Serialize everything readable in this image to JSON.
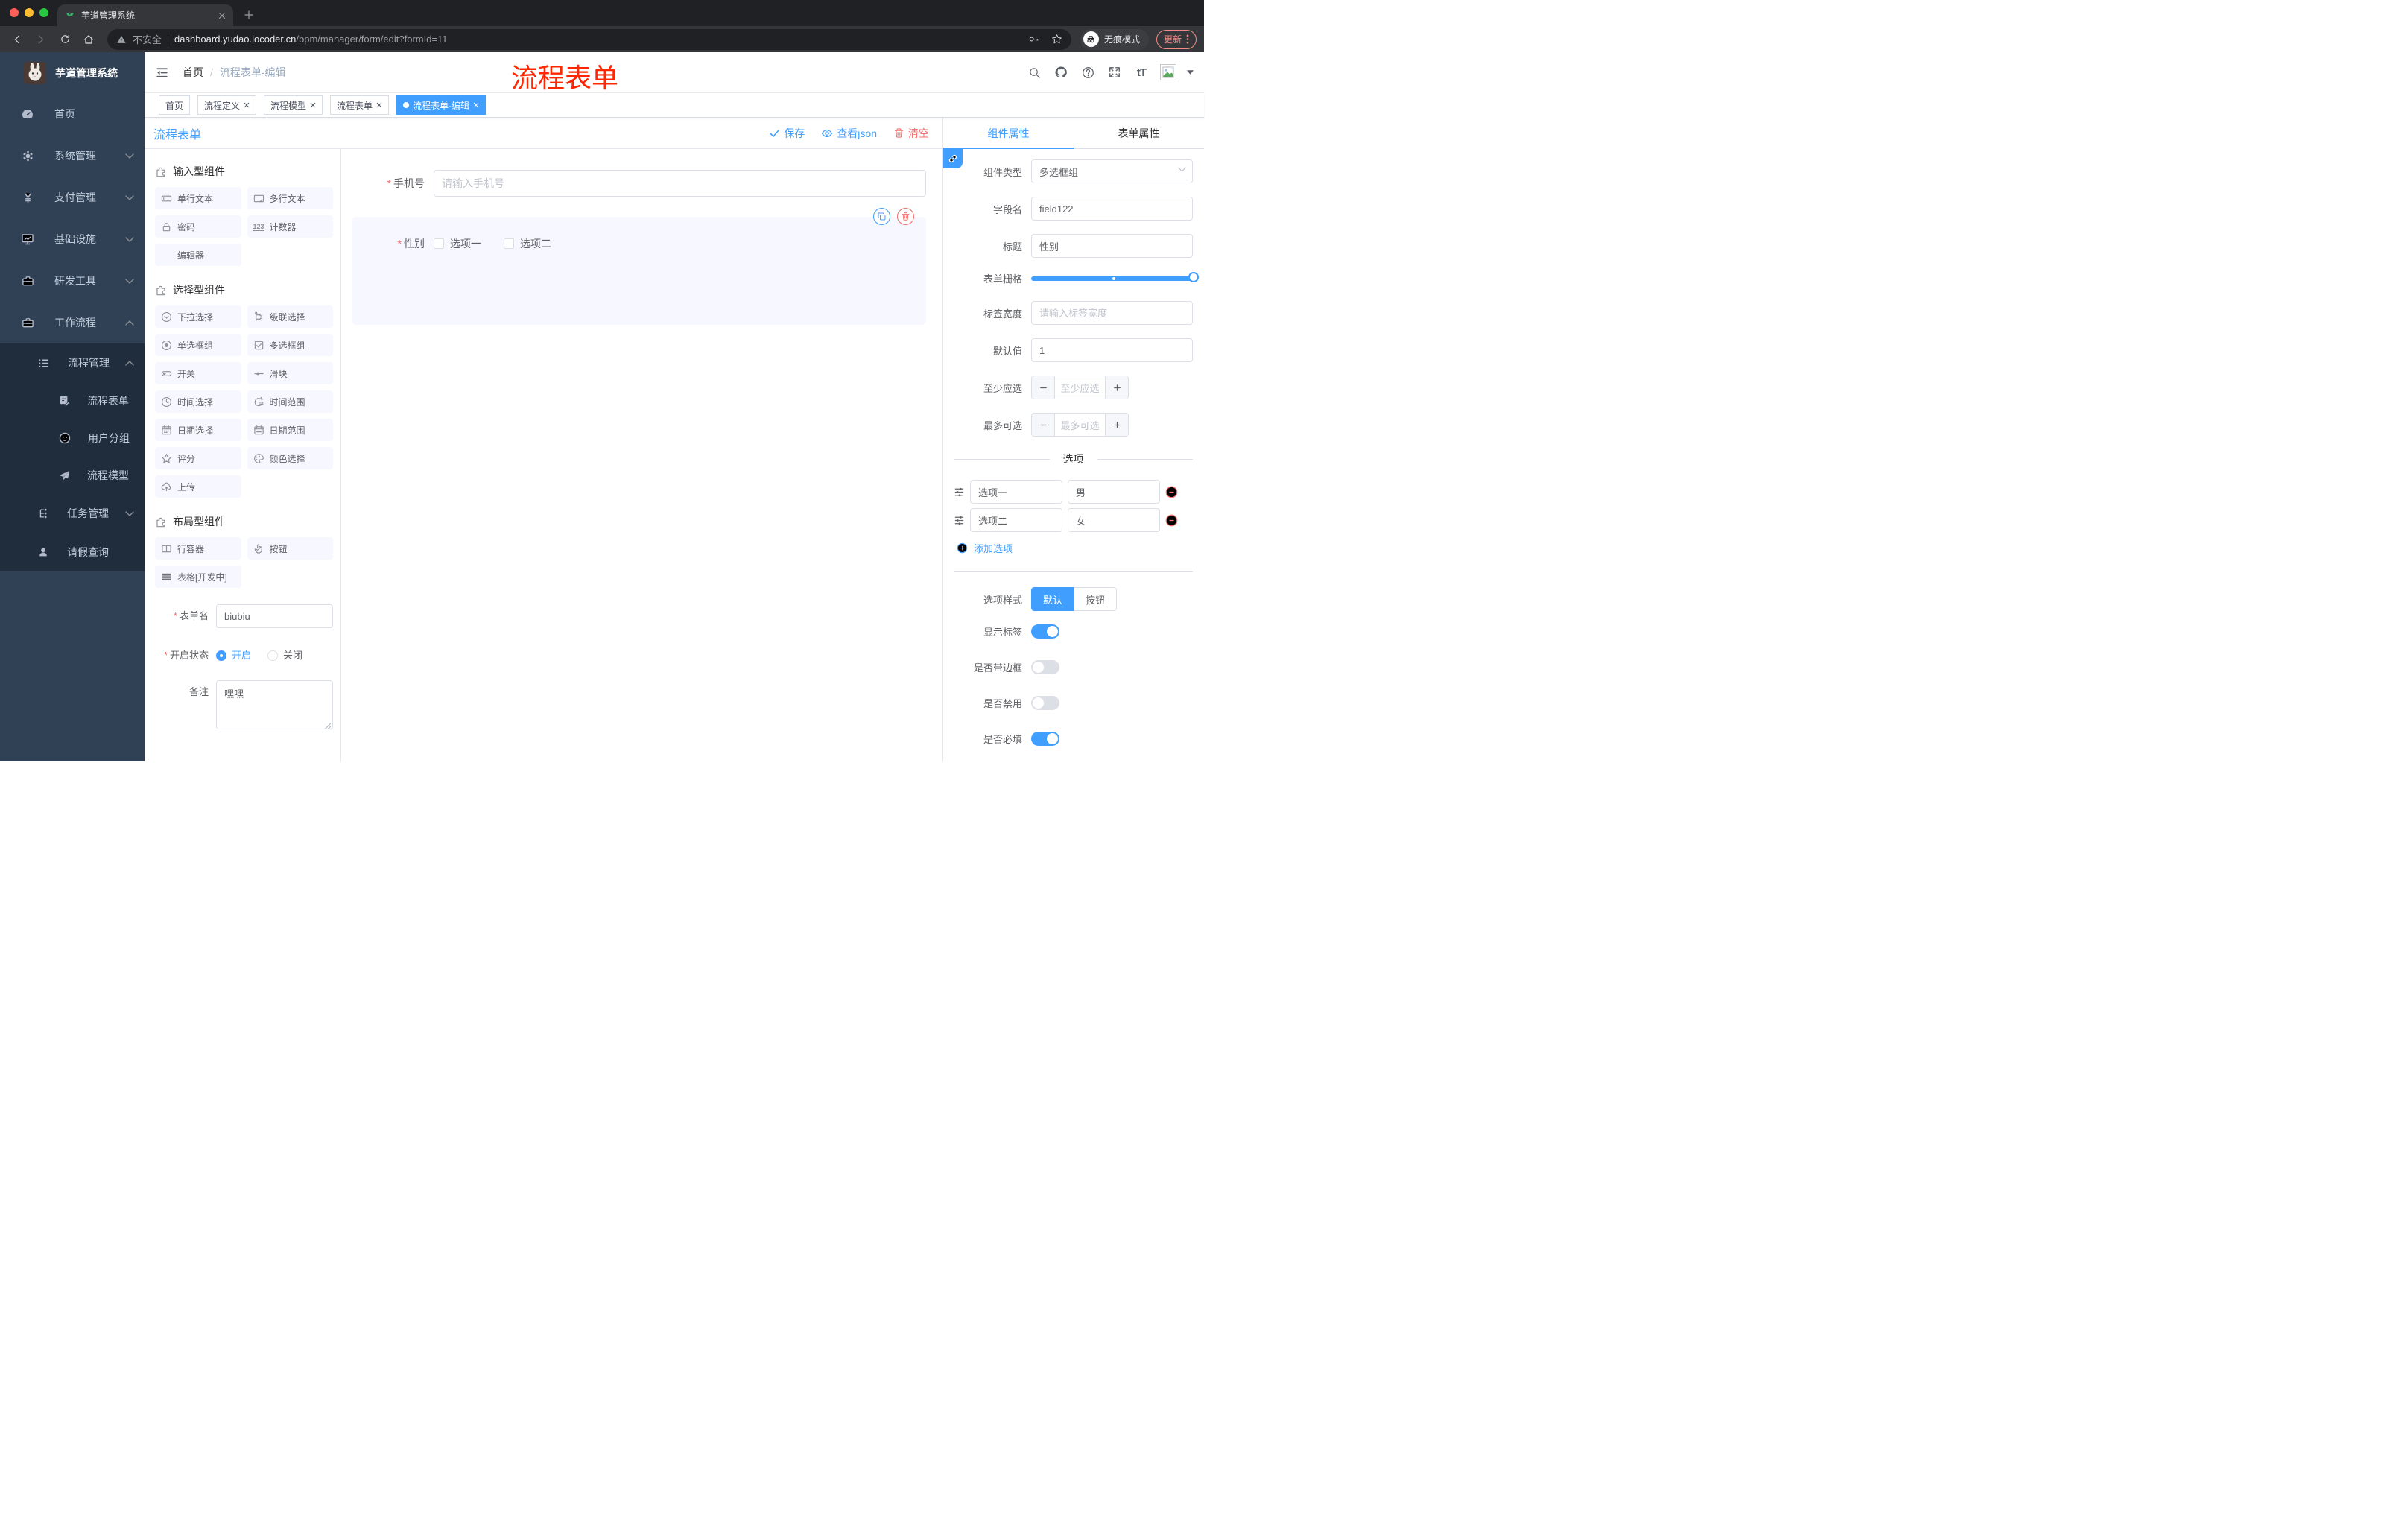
{
  "colors": {
    "primary": "#409EFF",
    "danger": "#F56C6C",
    "annotation_red": "#FF2600",
    "sidebar_bg": "#304156",
    "sidebar_sub_bg": "#1F2D3D"
  },
  "browser": {
    "tab_title": "芋道管理系统",
    "security_label": "不安全",
    "url_domain": "dashboard.yudao.iocoder.cn",
    "url_path": "/bpm/manager/form/edit?formId=11",
    "incognito_label": "无痕模式",
    "update_label": "更新"
  },
  "annotation": {
    "text": "流程表单"
  },
  "sidebar": {
    "logo_title": "芋道管理系统",
    "items": [
      {
        "label": "首页"
      },
      {
        "label": "系统管理"
      },
      {
        "label": "支付管理"
      },
      {
        "label": "基础设施"
      },
      {
        "label": "研发工具"
      },
      {
        "label": "工作流程"
      }
    ],
    "workflow": {
      "group1": {
        "label": "流程管理",
        "children": [
          {
            "label": "流程表单"
          },
          {
            "label": "用户分组"
          },
          {
            "label": "流程模型"
          }
        ]
      },
      "group2": {
        "label": "任务管理"
      },
      "leave_query": {
        "label": "请假查询"
      }
    }
  },
  "header": {
    "breadcrumb_home": "首页",
    "breadcrumb_sep": "/",
    "breadcrumb_current": "流程表单-编辑"
  },
  "tags": [
    {
      "label": "首页"
    },
    {
      "label": "流程定义"
    },
    {
      "label": "流程模型"
    },
    {
      "label": "流程表单"
    },
    {
      "label": "流程表单-编辑"
    }
  ],
  "designer": {
    "title": "流程表单",
    "save_label": "保存",
    "view_json_label": "查看json",
    "clear_label": "清空",
    "palette": {
      "sections": [
        {
          "title": "输入型组件",
          "items": [
            "单行文本",
            "多行文本",
            "密码",
            "计数器",
            "编辑器"
          ]
        },
        {
          "title": "选择型组件",
          "items": [
            "下拉选择",
            "级联选择",
            "单选框组",
            "多选框组",
            "开关",
            "滑块",
            "时间选择",
            "时间范围",
            "日期选择",
            "日期范围",
            "评分",
            "颜色选择",
            "上传"
          ]
        },
        {
          "title": "布局型组件",
          "items": [
            "行容器",
            "按钮",
            "表格[开发中]"
          ]
        }
      ],
      "counter_icon_text": "123"
    },
    "meta_form": {
      "form_name_label": "表单名",
      "form_name_value": "biubiu",
      "status_label": "开启状态",
      "status_on": "开启",
      "status_off": "关闭",
      "remark_label": "备注",
      "remark_value": "嘿嘿"
    },
    "canvas": {
      "phone_label": "手机号",
      "phone_placeholder": "请输入手机号",
      "gender_label": "性别",
      "gender_option1": "选项一",
      "gender_option2": "选项二"
    }
  },
  "panel": {
    "tab_component": "组件属性",
    "tab_form": "表单属性",
    "component_type_label": "组件类型",
    "component_type_value": "多选框组",
    "field_name_label": "字段名",
    "field_name_value": "field122",
    "title_label": "标题",
    "title_value": "性别",
    "grid_label": "表单栅格",
    "label_width_label": "标签宽度",
    "label_width_placeholder": "请输入标签宽度",
    "default_label": "默认值",
    "default_value": "1",
    "min_label": "至少应选",
    "min_placeholder": "至少应选",
    "max_label": "最多可选",
    "max_placeholder": "最多可选",
    "options_divider": "选项",
    "options": [
      {
        "label": "选项一",
        "value": "男"
      },
      {
        "label": "选项二",
        "value": "女"
      }
    ],
    "add_option_label": "添加选项",
    "style_label": "选项样式",
    "style_default": "默认",
    "style_button": "按钮",
    "switch_show_label": "显示标签",
    "switch_border": "是否带边框",
    "switch_disabled": "是否禁用",
    "switch_required": "是否必填",
    "font_size_icon_text": "tT"
  }
}
